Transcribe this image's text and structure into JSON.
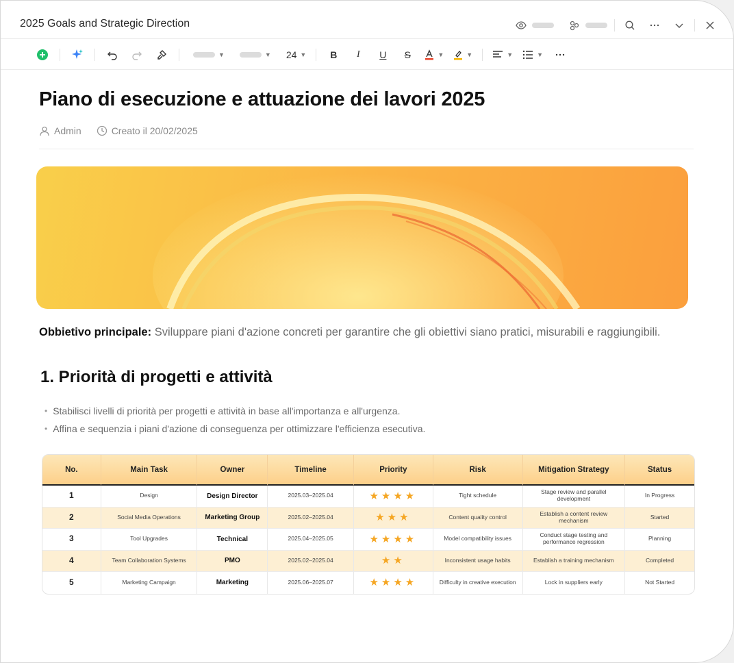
{
  "window": {
    "title": "2025 Goals and Strategic Direction"
  },
  "toolbar": {
    "font_size": "24"
  },
  "document": {
    "title": "Piano di esecuzione e attuazione dei lavori 2025",
    "author": "Admin",
    "created": "Creato il 20/02/2025",
    "objective_label": "Obbietivo principale:",
    "objective_text": " Sviluppare piani d'azione concreti per garantire che gli obiettivi siano pratici, misurabili e raggiungibili.",
    "section_title": "1. Priorità di progetti e attività",
    "bullets": [
      "Stabilisci livelli di priorità per progetti e attività in base all'importanza e all'urgenza.",
      "Affina e sequenzia i piani d'azione di conseguenza per ottimizzare l'efficienza esecutiva."
    ]
  },
  "table": {
    "headers": [
      "No.",
      "Main Task",
      "Owner",
      "Timeline",
      "Priority",
      "Risk",
      "Mitigation Strategy",
      "Status"
    ],
    "rows": [
      {
        "no": "1",
        "task": "Design",
        "owner": "Design Director",
        "timeline": "2025.03–2025.04",
        "priority": 4,
        "risk": "Tight schedule",
        "mitigation": "Stage review and parallel development",
        "status": "In Progress"
      },
      {
        "no": "2",
        "task": "Social Media Operations",
        "owner": "Marketing Group",
        "timeline": "2025.02–2025.04",
        "priority": 3,
        "risk": "Content quality control",
        "mitigation": "Establish a content review mechanism",
        "status": "Started"
      },
      {
        "no": "3",
        "task": "Tool Upgrades",
        "owner": "Technical",
        "timeline": "2025.04–2025.05",
        "priority": 4,
        "risk": "Model compatibility issues",
        "mitigation": "Conduct stage testing and performance regression",
        "status": "Planning"
      },
      {
        "no": "4",
        "task": "Team Collaboration Systems",
        "owner": "PMO",
        "timeline": "2025.02–2025.04",
        "priority": 2,
        "risk": "Inconsistent usage habits",
        "mitigation": "Establish a training mechanism",
        "status": "Completed"
      },
      {
        "no": "5",
        "task": "Marketing Campaign",
        "owner": "Marketing",
        "timeline": "2025.06–2025.07",
        "priority": 4,
        "risk": "Difficulty in creative execution",
        "mitigation": "Lock in suppliers early",
        "status": "Not Started"
      }
    ]
  },
  "colors": {
    "accent_green": "#1fbf6a",
    "table_header": "#fdd08a",
    "row_alt": "#fdefd3",
    "star": "#f5a623",
    "banner": "#fbb745"
  },
  "icons": [
    "eye-icon",
    "share-icon",
    "search-icon",
    "more-icon",
    "chevron-down-icon",
    "close-icon",
    "add-icon",
    "ai-sparkle-icon",
    "undo-icon",
    "redo-icon",
    "format-painter-icon",
    "user-icon",
    "clock-icon"
  ]
}
